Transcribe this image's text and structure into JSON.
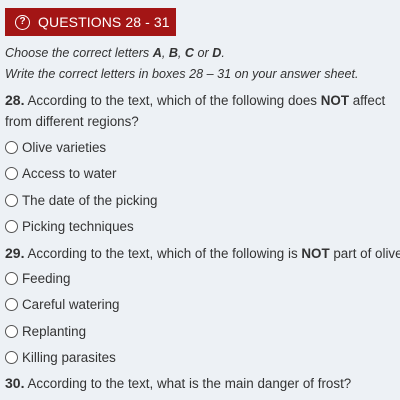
{
  "header": {
    "icon": "question-circle-icon",
    "icon_glyph": "?",
    "title": "QUESTIONS 28 - 31",
    "background": "#a31515"
  },
  "instructions": {
    "line1": {
      "prefix": "Choose the correct letters ",
      "letter_a": "A",
      "sep1": ", ",
      "letter_b": "B",
      "sep2": ", ",
      "letter_c": "C",
      "sep3": " or ",
      "letter_d": "D",
      "suffix": "."
    },
    "line2": "Write the correct letters in boxes 28 – 31 on your answer sheet."
  },
  "questions": [
    {
      "number": "28.",
      "text_before": " According to the text, which of the following does ",
      "emphasis": "NOT",
      "text_after": " affect",
      "continuation": "from different regions?",
      "options": [
        "Olive varieties",
        "Access to water",
        "The date of the picking",
        "Picking techniques"
      ]
    },
    {
      "number": "29.",
      "text_before": " According to the text, which of the following is ",
      "emphasis": "NOT",
      "text_after": " part of olive",
      "options": [
        "Feeding",
        "Careful watering",
        "Replanting",
        "Killing parasites"
      ]
    },
    {
      "number": "30.",
      "text": " According to the text, what is the main danger of frost?"
    }
  ]
}
